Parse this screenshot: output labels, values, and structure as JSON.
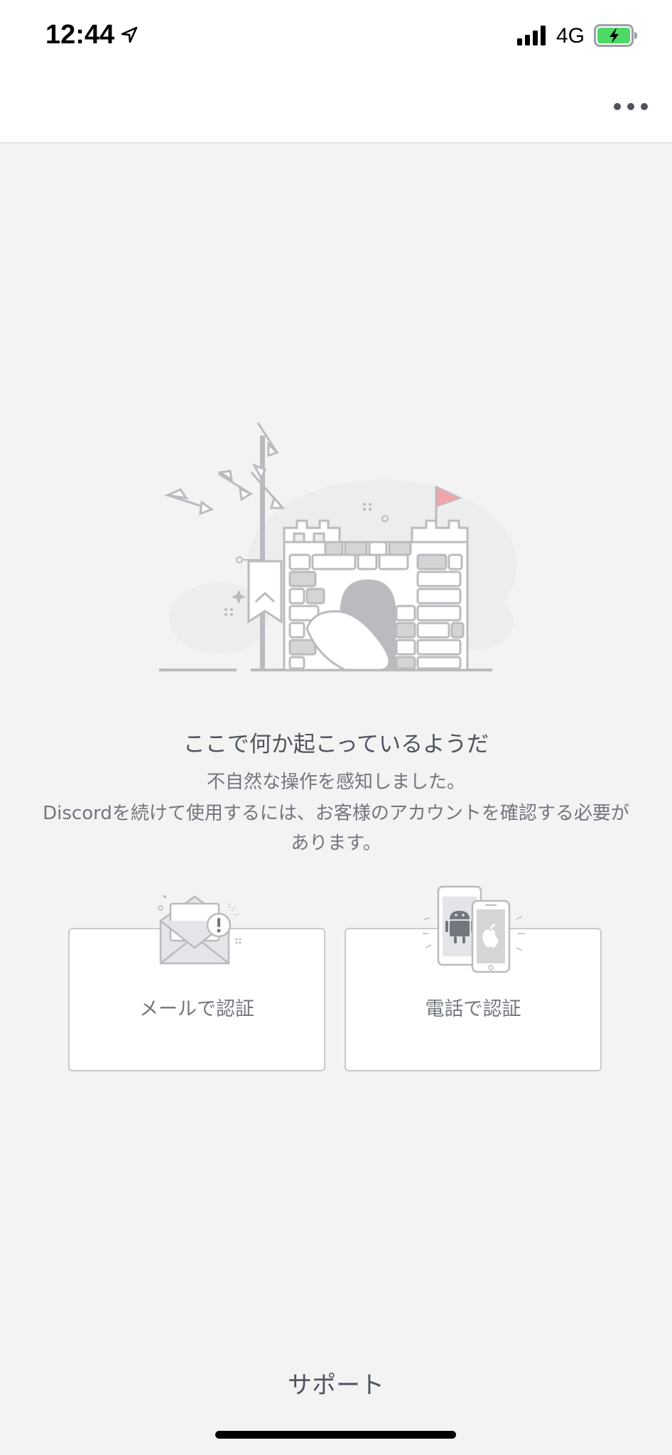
{
  "status_bar": {
    "time": "12:44",
    "network": "4G",
    "icons": [
      "location-arrow-icon",
      "cellular-signal-icon",
      "battery-charging-icon"
    ]
  },
  "nav": {
    "more_icon": "ellipsis-icon"
  },
  "illustration": {
    "name": "castle-icon"
  },
  "message": {
    "title": "ここで何か起こっているようだ",
    "line1": "不自然な操作を感知しました。",
    "line2": "Discordを続けて使用するには、お客様のアカウントを確認する必要があります。"
  },
  "options": [
    {
      "label": "メールで認証",
      "icon": "email-warning-icon"
    },
    {
      "label": "電話で認証",
      "icon": "phone-android-apple-icon"
    }
  ],
  "footer": {
    "support_label": "サポート"
  },
  "colors": {
    "background": "#f3f3f4",
    "card_border": "#c7c9cc",
    "flag": "#f4a4a8",
    "battery": "#4cd964"
  }
}
